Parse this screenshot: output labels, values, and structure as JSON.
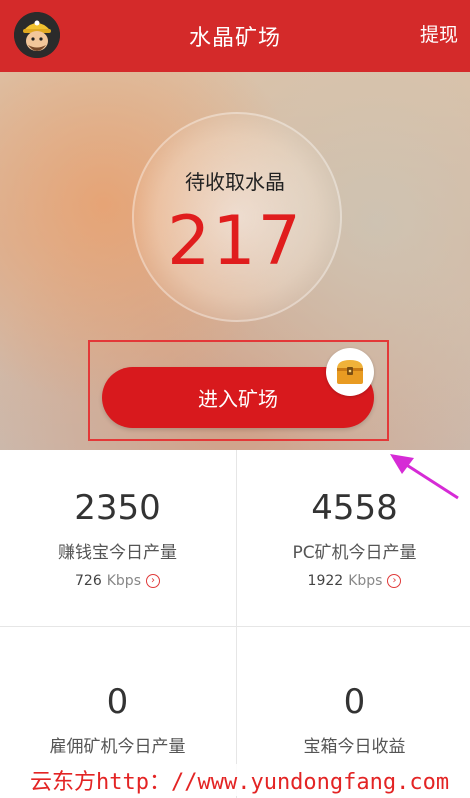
{
  "header": {
    "title": "水晶矿场",
    "withdraw_label": "提现",
    "avatar_icon": "miner-avatar-icon"
  },
  "hero": {
    "pending_label": "待收取水晶",
    "pending_value": "217",
    "enter_button_label": "进入矿场",
    "chest_icon": "treasure-chest-icon"
  },
  "stats": [
    {
      "value": "2350",
      "label": "赚钱宝今日产量",
      "speed": "726",
      "speed_unit": "Kbps"
    },
    {
      "value": "4558",
      "label": "PC矿机今日产量",
      "speed": "1922",
      "speed_unit": "Kbps"
    },
    {
      "value": "0",
      "label": "雇佣矿机今日产量"
    },
    {
      "value": "0",
      "label": "宝箱今日收益"
    }
  ],
  "watermark": "云东方http：//www.yundongfang.com",
  "colors": {
    "header_red": "#d42a2a",
    "button_red": "#d8191d",
    "value_red": "#e01d1d",
    "annotation_magenta": "#d62bd6"
  }
}
